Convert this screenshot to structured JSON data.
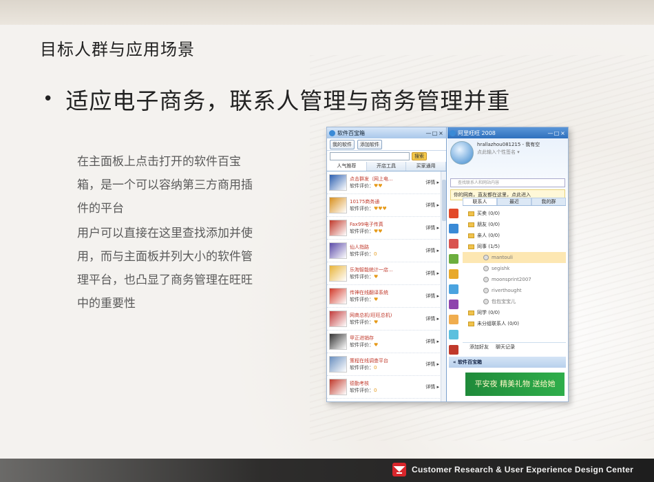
{
  "slide": {
    "title": "目标人群与应用场景",
    "bullet": "适应电子商务，联系人管理与商务管理并重",
    "desc_1": "在主面板上点击打开的软件百宝箱，是一个可以容纳第三方商用插件的平台",
    "desc_2": "用户可以直接在这里查找添加并使用，而与主面板并列大小的软件管理平台，也凸显了商务管理在旺旺中的重要性"
  },
  "software_box": {
    "window_title": "软件百宝箱",
    "ctl_min": "—",
    "ctl_max": "□",
    "ctl_close": "×",
    "my_software": "我的软件",
    "add_software": "添加软件",
    "search_btn": "搜索",
    "tabs": [
      "人气推荐",
      "开店工具",
      "买家通用"
    ],
    "rating_label": "软件评价：",
    "more_label": "详情 ▸",
    "items": [
      {
        "name": "点击群发（网上电...",
        "rating": "♥♥",
        "color": "#2c5fb0"
      },
      {
        "name": "10175商务通",
        "rating": "♥♥♥",
        "color": "#d8901e"
      },
      {
        "name": "Fax99电子传真",
        "rating": "♥♥",
        "color": "#c0392b"
      },
      {
        "name": "仙人指路",
        "rating": "0",
        "color": "#5b4aa8"
      },
      {
        "name": "乐淘智能统计一店...",
        "rating": "♥",
        "color": "#e8b43a"
      },
      {
        "name": "传神在线翻译系统",
        "rating": "♥",
        "color": "#d23a2a"
      },
      {
        "name": "网商总机(旺旺总机)",
        "rating": "♥",
        "color": "#c23b3b"
      },
      {
        "name": "甲正进销存",
        "rating": "♥",
        "color": "#333333"
      },
      {
        "name": "策程在线调查平台",
        "rating": "0",
        "color": "#6a8fbf"
      },
      {
        "name": "德勤考核",
        "rating": "0",
        "color": "#c0392b"
      }
    ]
  },
  "wangwang": {
    "window_title": "阿里旺旺 2008",
    "user": "hrallazhou081215 - 我有空",
    "signature": "点此输入个性签名 ▾",
    "search_placeholder": "查找联系人和网站内容",
    "notice": "你的网商，直友都在这里，点此进入",
    "tabs": [
      "联系人",
      "最近",
      "我的群"
    ],
    "groups": [
      {
        "label": "买卖 (0/0)",
        "type": "group"
      },
      {
        "label": "朋友 (0/0)",
        "type": "group"
      },
      {
        "label": "亲人 (0/0)",
        "type": "group"
      },
      {
        "label": "同事 (1/5)",
        "type": "group"
      },
      {
        "label": "mantouli",
        "type": "contact-sel"
      },
      {
        "label": "segishk",
        "type": "contact"
      },
      {
        "label": "moonsprint2007",
        "type": "contact"
      },
      {
        "label": "riverthought",
        "type": "contact"
      },
      {
        "label": "包包宝宝儿",
        "type": "contact"
      },
      {
        "label": "同学 (0/0)",
        "type": "group"
      },
      {
        "label": "未分组联系人 (0/0)",
        "type": "group"
      }
    ],
    "add_friend": "添加好友",
    "chat_log": "聊天记录",
    "sw_box_label": "« 软件百宝箱",
    "ad_text": "平安夜 精美礼物 送给她",
    "sidebar_colors": [
      "#e24a2a",
      "#3a8ad6",
      "#d9534f",
      "#6cae3e",
      "#e8a92a",
      "#4aa3df",
      "#8e44ad",
      "#f0ad4e",
      "#5bc0de",
      "#c0392b"
    ]
  },
  "footer": {
    "brand": "Customer Research & User Experience Design Center"
  }
}
